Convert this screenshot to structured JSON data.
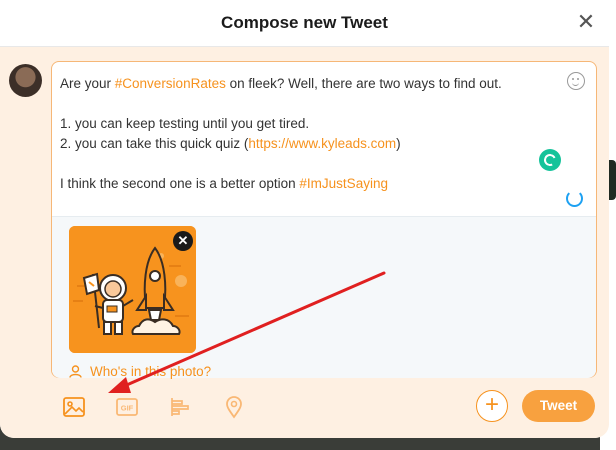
{
  "dialog": {
    "title": "Compose new Tweet",
    "close_icon": "close-icon",
    "close_symbol": "✕"
  },
  "composer": {
    "avatar_icon": "user-avatar",
    "text_lines": [
      [
        "Are your ",
        "#ConversionRates",
        " on fleek? Well, there are two ways to find out."
      ],
      [
        "1. you can keep testing until you get tired."
      ],
      [
        "2. you can take this quick quiz  (",
        "https://www.kyleads.com",
        ")"
      ],
      [
        "I think the second one is a better option ",
        "#ImJustSaying"
      ]
    ],
    "emoji_icon": "emoji-icon",
    "grammarly_icon": "grammarly-icon",
    "char_counter_icon": "progress-ring-icon"
  },
  "media": {
    "image_icon": "rocket-astronaut-illustration",
    "remove_symbol": "✕",
    "tag_people_label": "Who's in this photo?"
  },
  "toolbar": {
    "image_tool_icon": "image-icon",
    "gif_tool_icon": "gif-icon",
    "poll_tool_icon": "poll-icon",
    "location_tool_icon": "location-icon",
    "add_symbol": "+",
    "tweet_label": "Tweet"
  },
  "colors": {
    "accent": "#f6921e",
    "tweet_button": "#f8a13f",
    "body_background": "#fef0e2",
    "annotation_arrow": "#e02020"
  }
}
